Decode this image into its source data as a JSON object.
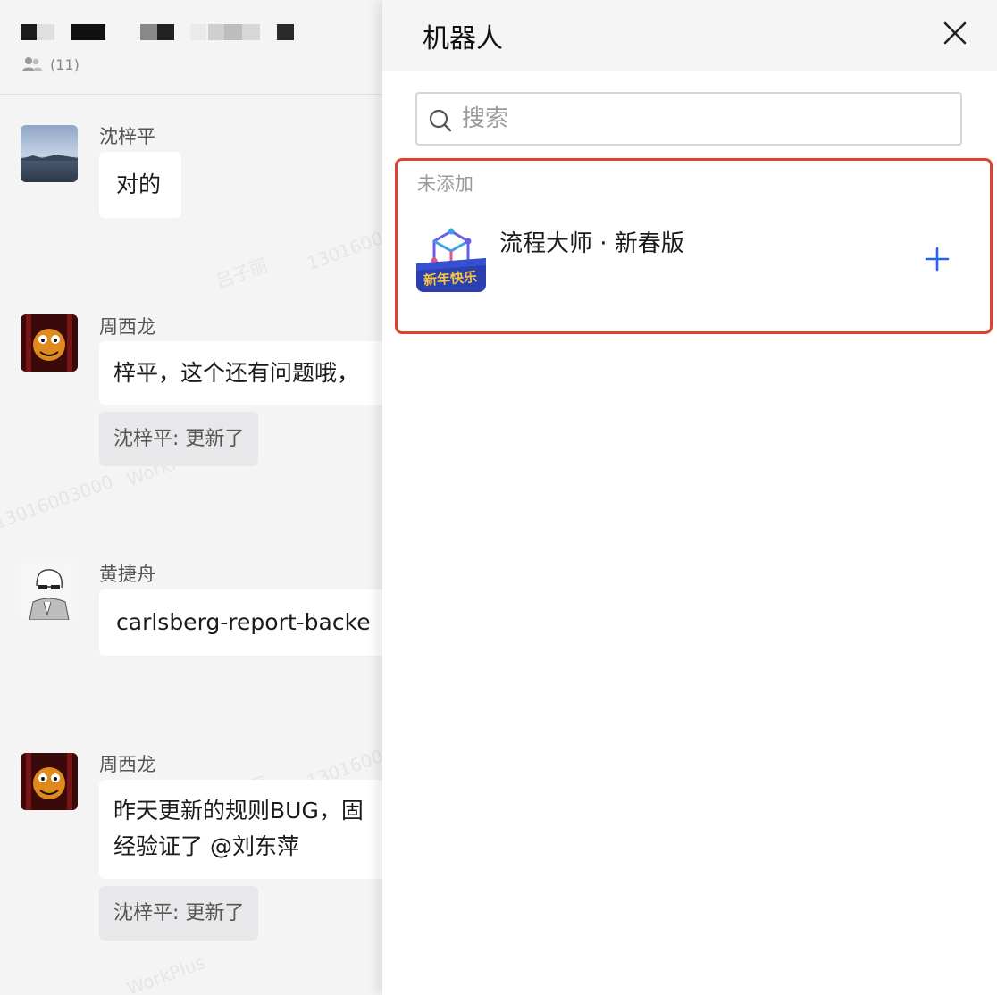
{
  "chat": {
    "member_count": "(11)",
    "messages": [
      {
        "sender": "沈梓平",
        "text": "对的"
      },
      {
        "sender": "周西龙",
        "text": "梓平，这个还有问题哦，",
        "reply": "沈梓平: 更新了"
      },
      {
        "sender": "黄捷舟",
        "text": "carlsberg-report-backe"
      },
      {
        "sender": "周西龙",
        "line1": "昨天更新的规则BUG，固",
        "line2": "经验证了 @刘东萍",
        "reply": "沈梓平: 更新了"
      }
    ],
    "watermark": {
      "name": "吕子丽",
      "number": "13016003000",
      "brand": "WorkPlus"
    }
  },
  "panel": {
    "title": "机器人",
    "search_placeholder": "搜索",
    "section_label": "未添加",
    "bot_name": "流程大师 · 新春版",
    "bot_badge": "新年快乐"
  },
  "colors": {
    "accent": "#2b63e8",
    "highlight": "#e0402f"
  },
  "icons": [
    "people-icon",
    "close-icon",
    "search-icon",
    "plus-icon"
  ]
}
